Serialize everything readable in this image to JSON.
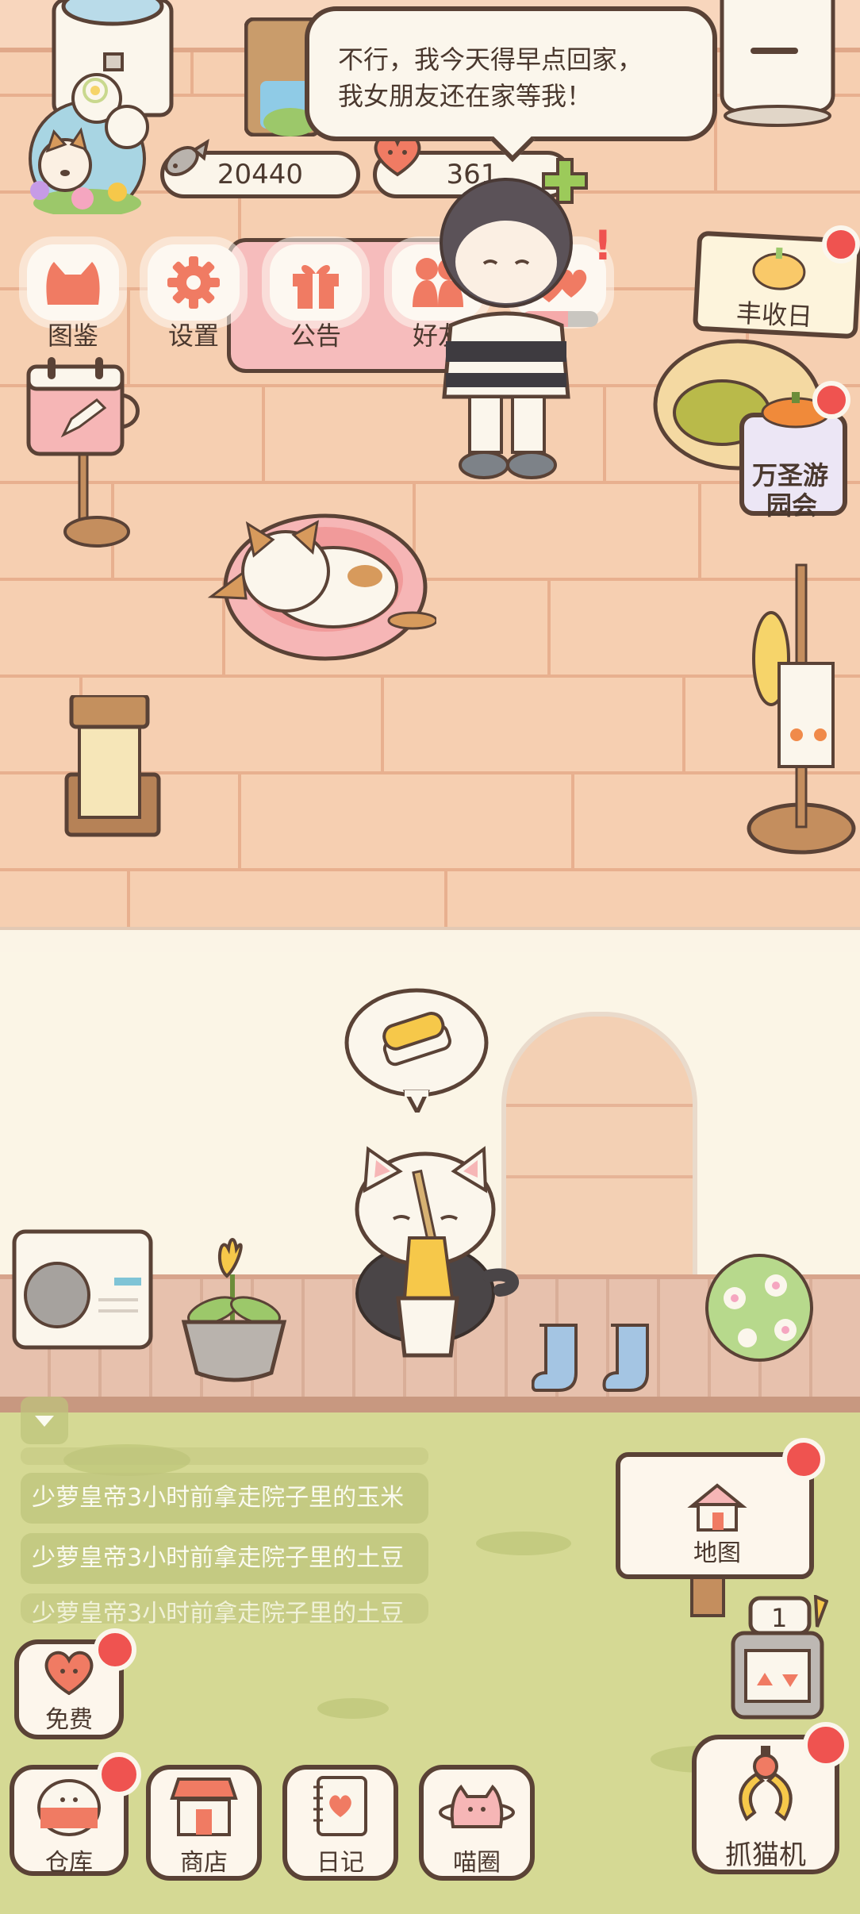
{
  "hud": {
    "fish_count": "20440",
    "heart_count": "361"
  },
  "speech_bubble": {
    "line1": "不行，我今天得早点回家，",
    "line2": "我女朋友还在家等我！"
  },
  "top_menu": [
    {
      "label": "图鉴",
      "icon": "cat-head-icon"
    },
    {
      "label": "设置",
      "icon": "gear-icon"
    },
    {
      "label": "公告",
      "icon": "gift-icon"
    },
    {
      "label": "好友",
      "icon": "friends-icon"
    }
  ],
  "events": {
    "harvest_label": "丰收日",
    "halloween_line1": "万圣游",
    "halloween_line2": "园会"
  },
  "activity_log": [
    "少萝皇帝3小时前拿走院子里的玉米",
    "少萝皇帝3小时前拿走院子里的土豆",
    "少萝皇帝3小时前拿走院子里的土豆"
  ],
  "map_label": "地图",
  "claw_counter": "1",
  "bottom_bar": {
    "free": "免费",
    "warehouse": "仓库",
    "shop": "商店",
    "diary": "日记",
    "circle": "喵圈",
    "claw_machine": "抓猫机"
  },
  "colors": {
    "outline": "#5a4236",
    "badge_red": "#ef5350",
    "icon_salmon": "#f07b63",
    "grass": "#d5d994",
    "floor": "#f6cfb1"
  }
}
